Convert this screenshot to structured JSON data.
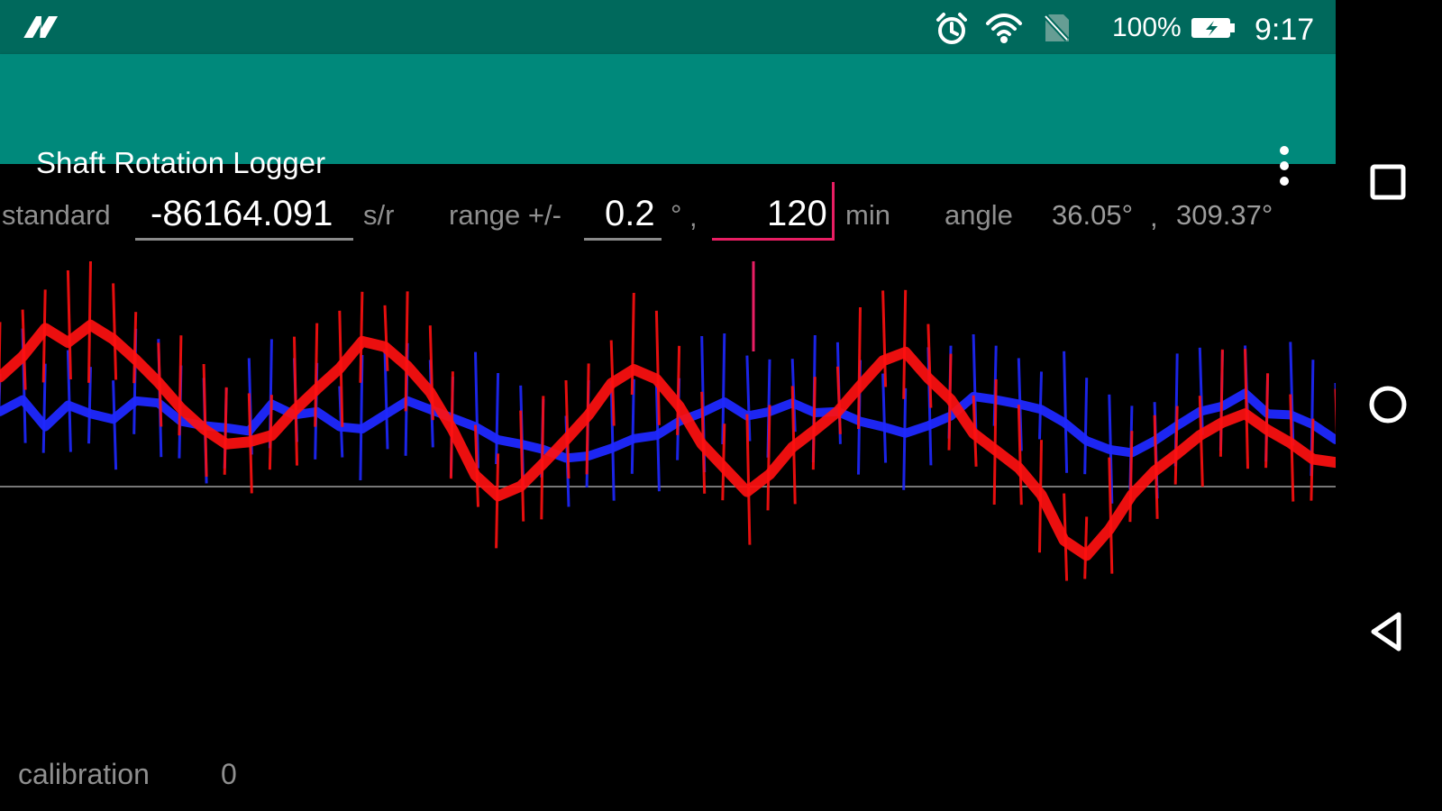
{
  "status_bar": {
    "battery_text": "100%",
    "time": "9:17",
    "icons": [
      "n-icon",
      "alarm-icon",
      "wifi-icon",
      "no-sim-icon",
      "battery-icon"
    ]
  },
  "app_bar": {
    "title": "Shaft Rotation Logger",
    "menu_icon": "overflow-menu-icon"
  },
  "controls": {
    "standard_label": "standard",
    "standard_value": "-86164.091",
    "standard_unit": "s/r",
    "range_label": "range +/-",
    "range_value": "0.2",
    "range_unit_degree": "°",
    "range_separator": ",",
    "time_value": "120",
    "time_unit": "min",
    "angle_label": "angle",
    "angle_value_1": "36.05°",
    "angle_separator": ",",
    "angle_value_2": "309.37°"
  },
  "calibration": {
    "label": "calibration",
    "value": "0"
  },
  "nav": {
    "icons": [
      "recent-apps-icon",
      "home-icon",
      "back-icon"
    ]
  },
  "colors": {
    "status_bar": "#00695C",
    "app_bar": "#00897B",
    "accent": "#e91e63",
    "blue_series": "#1f28ff",
    "red_series": "#ff1010",
    "baseline": "#777777"
  },
  "chart_data": {
    "type": "line",
    "series": [
      {
        "values": [
          0.061,
          0.072,
          0.047,
          0.067,
          0.059,
          0.054,
          0.071,
          0.069,
          0.052,
          0.048,
          0.046,
          0.043,
          0.068,
          0.058,
          0.061,
          0.047,
          0.045,
          0.058,
          0.071,
          0.063,
          0.055,
          0.047,
          0.035,
          0.031,
          0.026,
          0.018,
          0.02,
          0.027,
          0.036,
          0.039,
          0.052,
          0.06,
          0.07,
          0.057,
          0.061,
          0.069,
          0.06,
          0.061,
          0.052,
          0.047,
          0.041,
          0.048,
          0.057,
          0.075,
          0.072,
          0.068,
          0.063,
          0.051,
          0.034,
          0.026,
          0.023,
          0.034,
          0.048,
          0.061,
          0.066,
          0.078,
          0.059,
          0.058,
          0.049,
          0.035
        ]
      },
      {
        "values": [
          0.093,
          0.112,
          0.138,
          0.125,
          0.141,
          0.128,
          0.109,
          0.088,
          0.064,
          0.045,
          0.031,
          0.033,
          0.039,
          0.062,
          0.082,
          0.101,
          0.126,
          0.121,
          0.103,
          0.079,
          0.044,
          0.002,
          -0.017,
          -0.008,
          0.013,
          0.035,
          0.058,
          0.087,
          0.1,
          0.091,
          0.066,
          0.031,
          0.009,
          -0.013,
          0.003,
          0.028,
          0.044,
          0.061,
          0.085,
          0.108,
          0.116,
          0.092,
          0.072,
          0.041,
          0.025,
          0.009,
          -0.016,
          -0.058,
          -0.072,
          -0.048,
          -0.016,
          0.006,
          0.022,
          0.039,
          0.051,
          0.059,
          0.044,
          0.032,
          0.017,
          0.014
        ]
      }
    ],
    "ylim": [
      -0.2,
      0.2
    ],
    "grid": false,
    "legend": "none"
  }
}
